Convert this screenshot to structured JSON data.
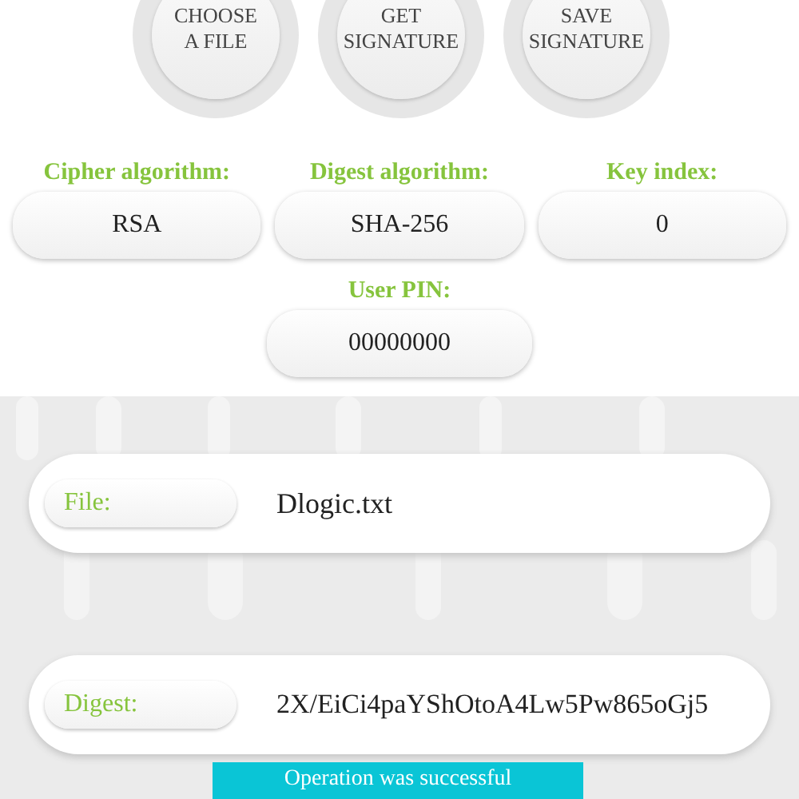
{
  "actions": [
    {
      "label": "CHOOSE\nA FILE"
    },
    {
      "label": "GET\nSIGNATURE"
    },
    {
      "label": "SAVE\nSIGNATURE"
    }
  ],
  "settings": [
    {
      "label": "Cipher algorithm:",
      "value": "RSA"
    },
    {
      "label": "Digest algorithm:",
      "value": "SHA-256"
    },
    {
      "label": "Key index:",
      "value": "0"
    }
  ],
  "user_pin": {
    "label": "User PIN:",
    "value": "00000000"
  },
  "results": [
    {
      "label": "File:",
      "value": "Dlogic.txt"
    },
    {
      "label": "Digest:",
      "value": "2X/EiCi4paYShOtoA4Lw5Pw865oGj5"
    }
  ],
  "toast": {
    "text": "Operation was successful"
  }
}
